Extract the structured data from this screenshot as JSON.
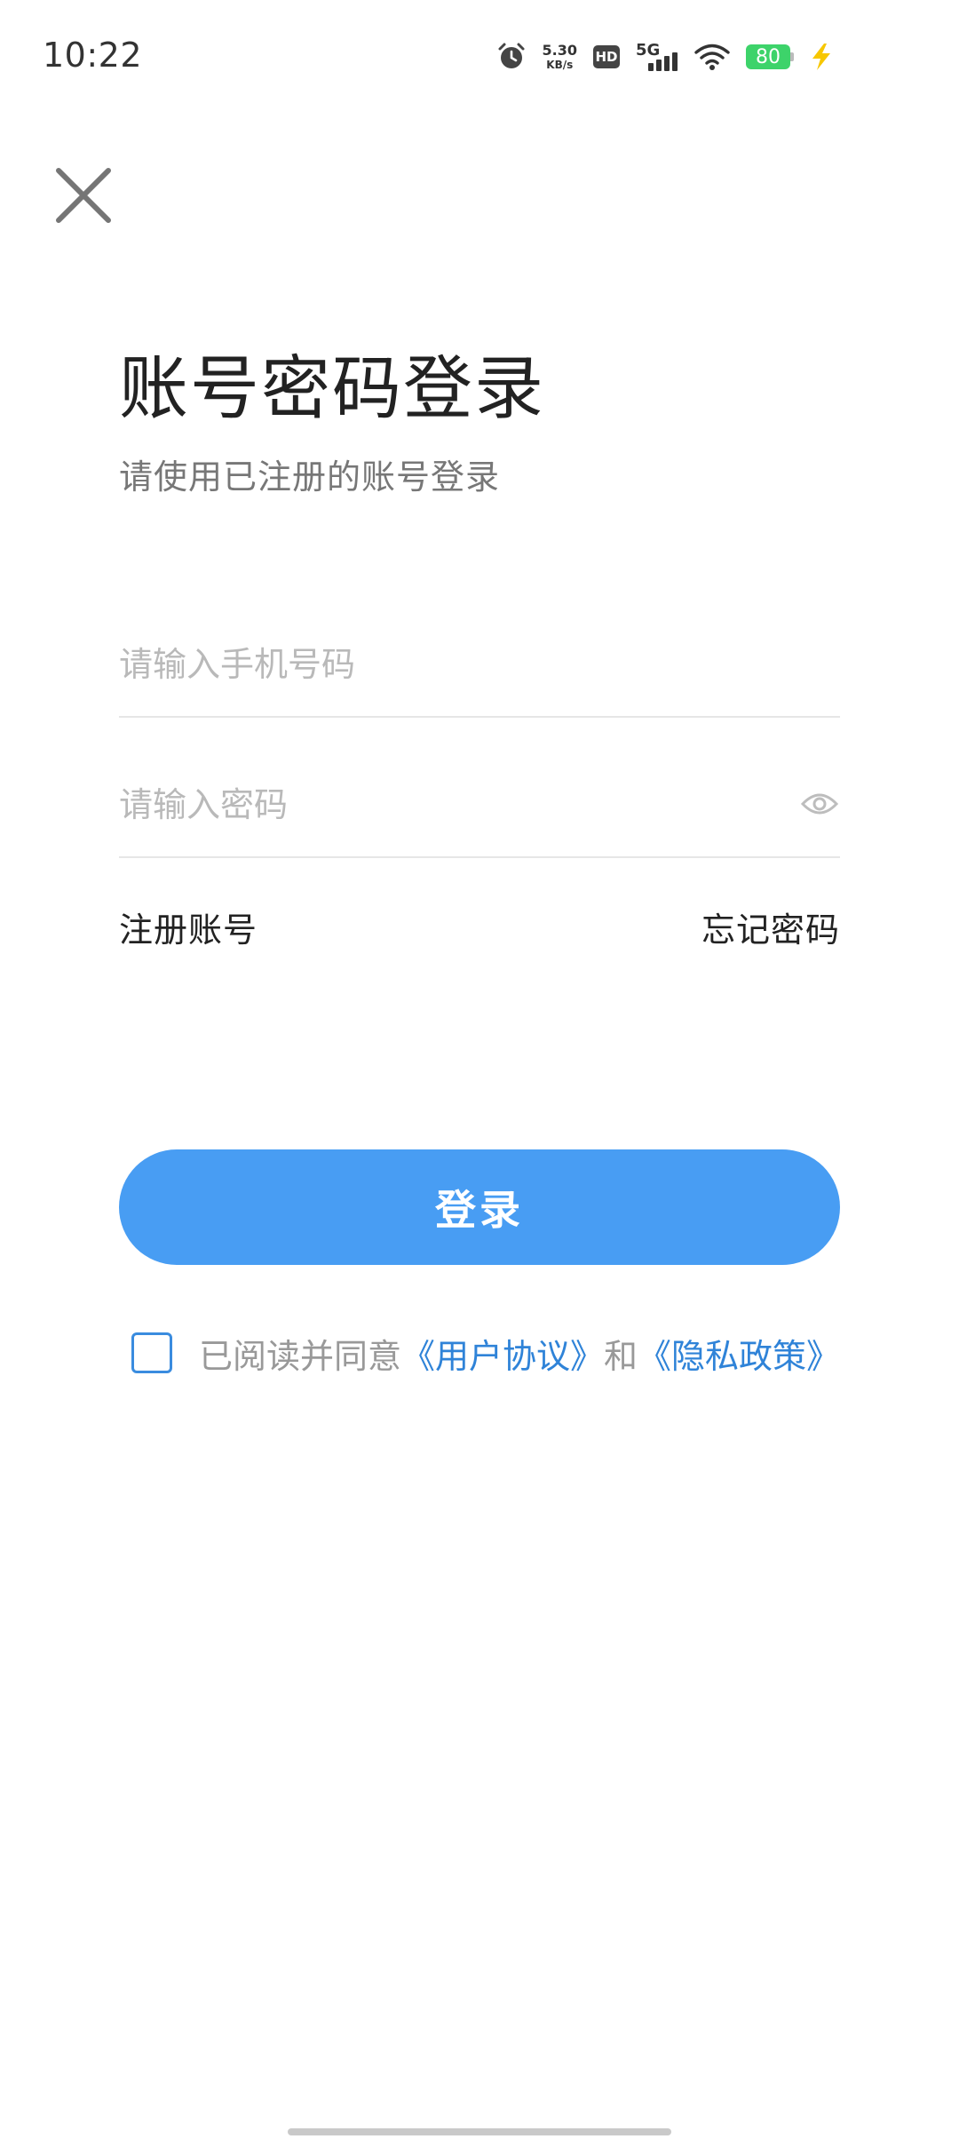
{
  "status_bar": {
    "time": "10:22",
    "net_speed_value": "5.30",
    "net_speed_unit": "KB/s",
    "hd_label": "HD",
    "network_type": "5G",
    "battery_level": "80",
    "icons": [
      "alarm-icon",
      "net-speed",
      "hd-icon",
      "signal-icon",
      "wifi-icon",
      "battery-icon",
      "charging-icon"
    ]
  },
  "header": {
    "close_icon": "close-icon"
  },
  "login": {
    "title": "账号密码登录",
    "subtitle": "请使用已注册的账号登录",
    "phone_placeholder": "请输入手机号码",
    "phone_value": "",
    "password_placeholder": "请输入密码",
    "password_value": "",
    "register_label": "注册账号",
    "forgot_label": "忘记密码",
    "submit_label": "登录"
  },
  "agreement": {
    "checked": false,
    "prefix": "已阅读并同意",
    "user_agreement": "《用户协议》",
    "conjunction": "和",
    "privacy_policy": "《隐私政策》"
  },
  "colors": {
    "primary": "#489df3",
    "link": "#2f83d8",
    "checkbox_border": "#3a8cdf",
    "battery": "#3dd36a",
    "charging": "#f7c700"
  }
}
